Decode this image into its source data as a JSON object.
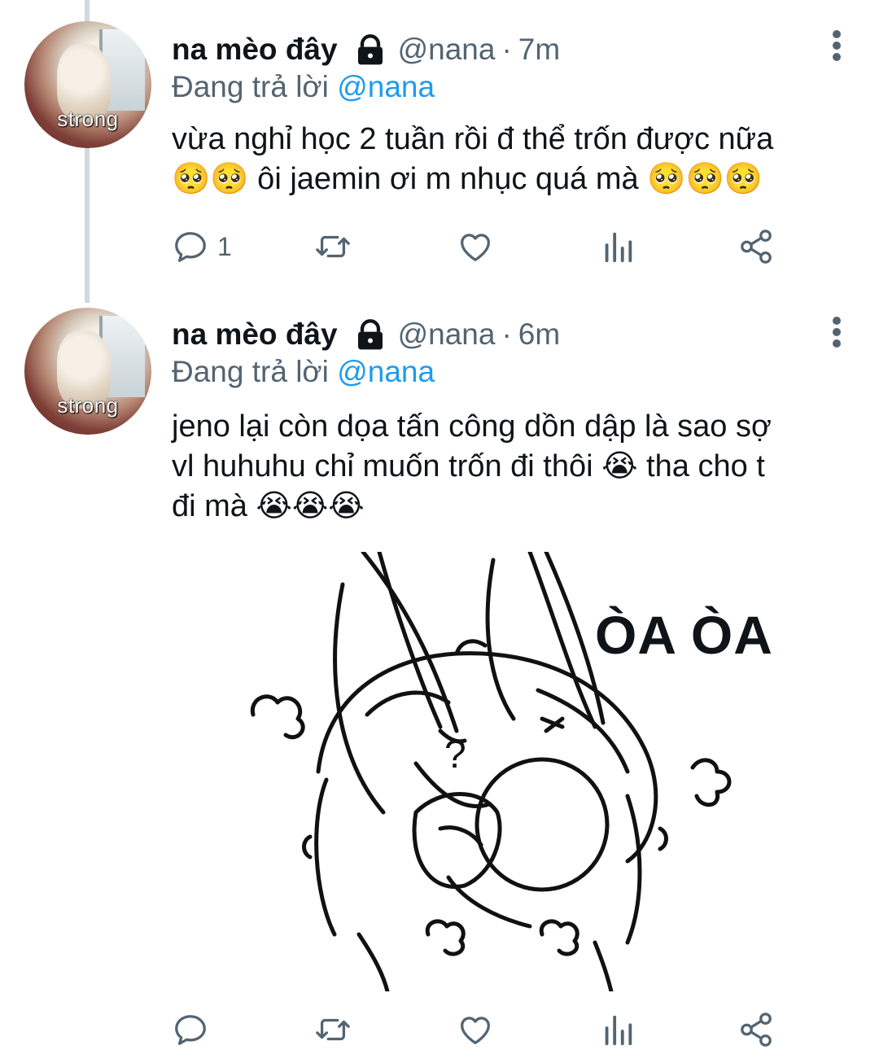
{
  "tweets": [
    {
      "author": {
        "display_name": "na mèo đây",
        "handle": "@nana",
        "avatar_caption": "strong",
        "protected_icon": "lock-icon"
      },
      "time": "7m",
      "dot": "·",
      "reply_prefix": "Đang trả lời",
      "reply_to": "@nana",
      "text_line1": "vừa nghỉ học 2 tuần rồi đ thể trốn được nữa",
      "text_line2": "🥺🥺 ôi jaemin ơi m nhục quá mà 🥺🥺🥺",
      "reply_count": "1"
    },
    {
      "author": {
        "display_name": "na mèo đây",
        "handle": "@nana",
        "avatar_caption": "strong",
        "protected_icon": "lock-icon"
      },
      "time": "6m",
      "dot": "·",
      "reply_prefix": "Đang trả lời",
      "reply_to": "@nana",
      "text_line1": "jeno lại còn dọa tấn công dồn dập là sao sợ",
      "text_line2": "vl huhuhu chỉ muốn trốn đi thôi 😭 tha cho t",
      "text_line3": "đi mà 😭😭😭",
      "reply_count": "",
      "media": {
        "caption_text": "ÒA ÒA",
        "icon": "crying-bunny-drawing"
      }
    }
  ],
  "colors": {
    "text": "#0f1419",
    "secondary": "#536471",
    "accent": "#1d9bf0",
    "thread_line": "#cfd9de"
  },
  "action_icons": [
    "reply-icon",
    "retweet-icon",
    "like-icon",
    "analytics-icon",
    "share-icon"
  ]
}
